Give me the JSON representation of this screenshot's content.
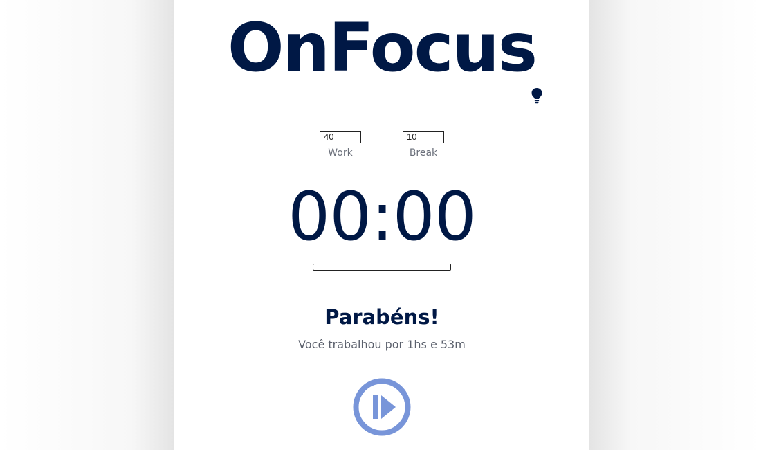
{
  "app": {
    "title": "OnFocus"
  },
  "settings": {
    "work": {
      "value": "40",
      "label": "Work"
    },
    "break": {
      "value": "10",
      "label": "Break"
    }
  },
  "timer": {
    "display": "00:00",
    "progress_fraction": 0
  },
  "message": {
    "heading": "Parabéns!",
    "summary": "Você trabalhou por 1hs e 53m"
  },
  "icons": {
    "theme_toggle": "lightbulb-icon",
    "start": "play-pause-icon"
  },
  "colors": {
    "primary": "#001845",
    "accent": "#7895d9",
    "muted_text": "#6a6f7a"
  }
}
